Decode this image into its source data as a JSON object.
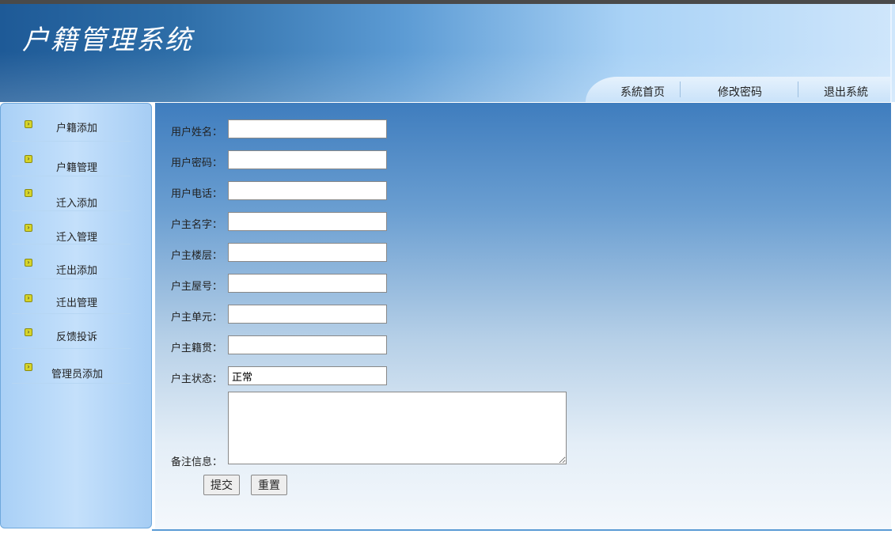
{
  "header": {
    "title": "户籍管理系统",
    "nav": [
      "系統首页",
      "修改密码",
      "退出系統"
    ]
  },
  "sidebar": {
    "items": [
      {
        "label": "户籍添加"
      },
      {
        "label": "户籍管理"
      },
      {
        "label": "迁入添加"
      },
      {
        "label": "迁入管理"
      },
      {
        "label": "迁出添加"
      },
      {
        "label": "迁出管理"
      },
      {
        "label": "反馈投诉"
      },
      {
        "label": "管理员添加"
      }
    ]
  },
  "form": {
    "fields": [
      {
        "label": "用户姓名：",
        "value": ""
      },
      {
        "label": "用户密码：",
        "value": ""
      },
      {
        "label": "用户电话：",
        "value": ""
      },
      {
        "label": "户主名字：",
        "value": ""
      },
      {
        "label": "户主楼层：",
        "value": ""
      },
      {
        "label": "户主屋号：",
        "value": ""
      },
      {
        "label": "户主单元：",
        "value": ""
      },
      {
        "label": "户主籍贯：",
        "value": ""
      },
      {
        "label": "户主状态：",
        "value": "正常"
      }
    ],
    "remark_label": "备注信息：",
    "remark_value": "",
    "submit_label": "提交",
    "reset_label": "重置"
  }
}
